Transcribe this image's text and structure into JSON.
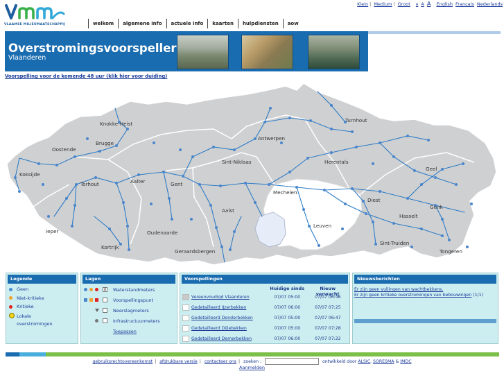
{
  "utility": {
    "sizes": [
      "Klein",
      "Medium",
      "Groot"
    ],
    "a_sizes": [
      "A",
      "A",
      "A"
    ],
    "languages": [
      "English",
      "Français",
      "Nederlands"
    ]
  },
  "logo": {
    "text": "Vmm",
    "subtitle": "VLAAMSE MILIEUMAATSCHAPPIJ"
  },
  "nav": [
    "welkom",
    "algemene info",
    "actuele info",
    "kaarten",
    "hulpdiensten",
    "aow"
  ],
  "banner": {
    "title": "Overstromingsvoorspeller",
    "subtitle": "Vlaanderen"
  },
  "forecast_link": "Voorspelling voor de komende 48 uur (klik hier voor duiding)",
  "map": {
    "cities": [
      "Knokke-Heist",
      "Oostende",
      "Brugge",
      "Koksijde",
      "Torhout",
      "Aalter",
      "Gent",
      "Sint-Niklaas",
      "Antwerpen",
      "Turnhout",
      "Herentals",
      "Geel",
      "Mechelen",
      "Aalst",
      "Oudenaarde",
      "Kortrijk",
      "Ieper",
      "Geraardsbergen",
      "Leuven",
      "Diest",
      "Hasselt",
      "Genk",
      "Sint-Truiden",
      "Tongeren"
    ]
  },
  "legend": {
    "title": "Legende",
    "items": [
      {
        "label": "Geen",
        "color": "#4a8ad0"
      },
      {
        "label": "Niet-kritieke",
        "color": "#f0a030"
      },
      {
        "label": "Kritieke",
        "color": "#e02020"
      },
      {
        "label": "Lokale overstromingen",
        "icon": "smiley-icon"
      }
    ]
  },
  "lagen": {
    "title": "Lagen",
    "items": [
      {
        "label": "Waterstandmeters",
        "checked": true
      },
      {
        "label": "Voorspellingspunt",
        "checked": false
      },
      {
        "label": "Neerslagmeters",
        "checked": false
      },
      {
        "label": "Infrastructuurmeters",
        "checked": false
      }
    ],
    "apply": "Toepassen",
    "check_mark": "x"
  },
  "voorspellingen": {
    "title": "Voorspellingen",
    "col_now": "Huidige sinds",
    "col_expected": "Nieuw verwacht",
    "rows": [
      {
        "name": "Vereenvoudigd Vlaanderen",
        "now": "07/07 05:00",
        "expected": "07/07 06:46",
        "grey": true
      },
      {
        "name": "Gedetailleerd IJzerbekken",
        "now": "07/07 06:00",
        "expected": "07/07 07:25",
        "grey": false
      },
      {
        "name": "Gedetailleerd Denderbekken",
        "now": "07/07 05:00",
        "expected": "07/07 06:47",
        "grey": false
      },
      {
        "name": "Gedetailleerd Dijlebekken",
        "now": "07/07 05:00",
        "expected": "07/07 07:28",
        "grey": false
      },
      {
        "name": "Gedetailleerd Demerbekken",
        "now": "07/07 06:00",
        "expected": "07/07 07:22",
        "grey": false
      }
    ]
  },
  "nieuws": {
    "title": "Nieuwsberichten",
    "line1": "Er zijn geen vullingen van wachtbekkens.",
    "line2": "Er zijn geen kritieke overstromingen van bebouwingen",
    "line2_count": "(1/1)"
  },
  "footer": {
    "links": [
      "gebruiksrechtovereenkomst",
      "afdrukbare versie",
      "contacteer ons"
    ],
    "search_label": "zoeken :",
    "developed_by": "ontwikkeld door",
    "devs": [
      "ALSIC",
      "SORESMA"
    ],
    "amp": "&",
    "dev_last": "IMDC",
    "login": "Aanmelden"
  }
}
